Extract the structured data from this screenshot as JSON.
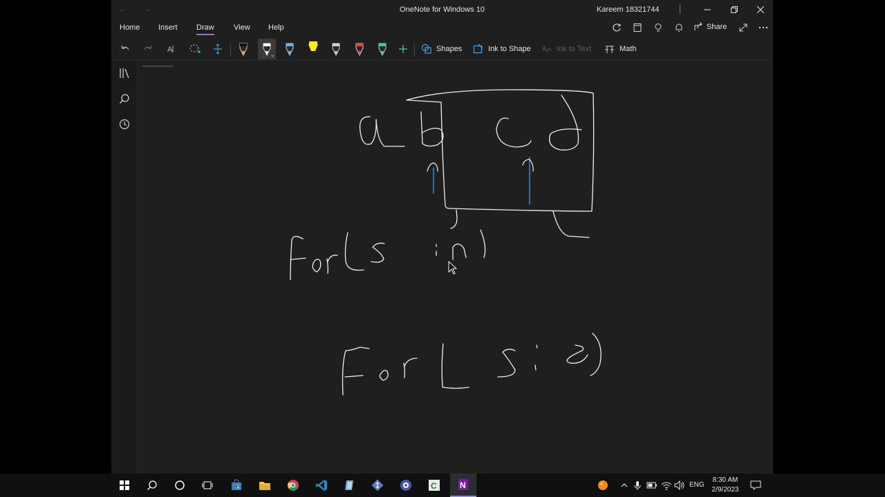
{
  "window": {
    "title": "OneNote for Windows 10",
    "user": "Kareem 18321744"
  },
  "menu": {
    "tabs": [
      "Home",
      "Insert",
      "Draw",
      "View",
      "Help"
    ],
    "active_tab": "Draw",
    "share_label": "Share"
  },
  "toolbar": {
    "shapes_label": "Shapes",
    "ink_to_shape_label": "Ink to Shape",
    "ink_to_text_label": "Ink to Text",
    "math_label": "Math",
    "pens": [
      {
        "name": "pen-black",
        "color": "#111111"
      },
      {
        "name": "pen-white-selected",
        "color": "#ffffff"
      },
      {
        "name": "pen-blue",
        "color": "#5fb3f0"
      },
      {
        "name": "highlighter-yellow",
        "color": "#f6ea22"
      },
      {
        "name": "pen-gray",
        "color": "#cfcfcf"
      },
      {
        "name": "pen-red",
        "color": "#e8443a"
      },
      {
        "name": "pen-teal",
        "color": "#3fc6b0"
      }
    ]
  },
  "canvas": {
    "ink_color": "#f0f0f0",
    "accent_ink_color": "#3d9be9"
  },
  "taskbar": {
    "time": "8:30 AM",
    "date": "2/9/2023",
    "language": "ENG"
  }
}
